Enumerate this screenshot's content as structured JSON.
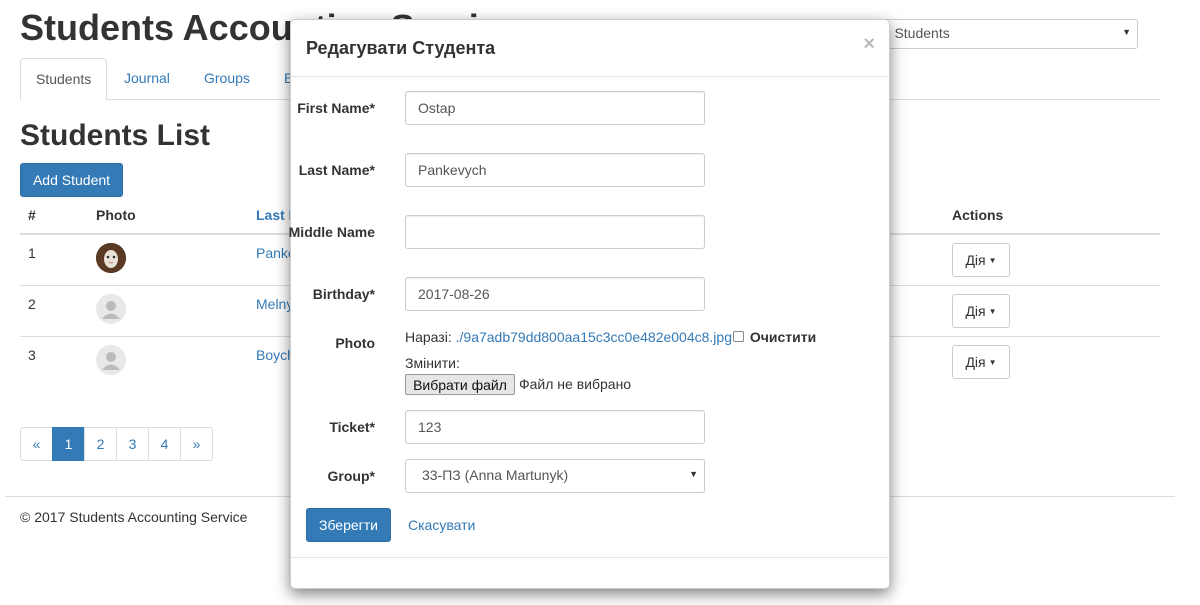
{
  "app": {
    "title": "Students Accounting Service",
    "group_selector_value": "All Students"
  },
  "tabs": [
    {
      "label": "Students"
    },
    {
      "label": "Journal"
    },
    {
      "label": "Groups"
    },
    {
      "label": "Exams"
    }
  ],
  "main": {
    "list_title": "Students List",
    "add_button": "Add Student",
    "columns": {
      "num": "#",
      "photo": "Photo",
      "last_name": "Last Name",
      "actions": "Actions"
    },
    "rows": [
      {
        "num": "1",
        "last_name": "Pankevych",
        "action": "Дія"
      },
      {
        "num": "2",
        "last_name": "Melnyk",
        "action": "Дія"
      },
      {
        "num": "3",
        "last_name": "Boychuk",
        "action": "Дія"
      }
    ],
    "pagination": [
      "«",
      "1",
      "2",
      "3",
      "4",
      "»"
    ],
    "active_page": "1"
  },
  "footer": {
    "text": "© 2017 Students Accounting Service"
  },
  "modal": {
    "title": "Редагувати Студента",
    "close": "×",
    "fields": {
      "first_name": {
        "label": "First Name*",
        "value": "Ostap"
      },
      "last_name": {
        "label": "Last Name*",
        "value": "Pankevych"
      },
      "middle_name": {
        "label": "Middle Name",
        "value": ""
      },
      "birthday": {
        "label": "Birthday*",
        "value": "2017-08-26"
      },
      "photo": {
        "label": "Photo",
        "current_prefix": "Наразі:",
        "current_file": "./9a7adb79dd800aa15c3cc0e482e004c8.jpg",
        "clear_label": "Очистити",
        "change_label": "Змінити:",
        "choose_button": "Вибрати файл",
        "no_file": "Файл не вибрано"
      },
      "ticket": {
        "label": "Ticket*",
        "value": "123"
      },
      "group": {
        "label": "Group*",
        "value": "33-ПЗ (Anna Martunyk)"
      }
    },
    "save_button": "Зберегти",
    "cancel_link": "Скасувати"
  }
}
